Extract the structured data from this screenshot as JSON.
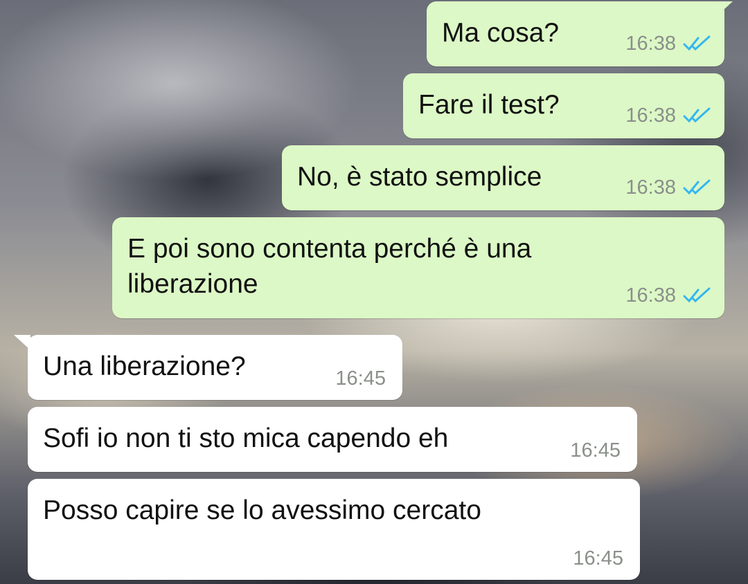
{
  "colors": {
    "outgoing_bubble": "#dcf8c6",
    "incoming_bubble": "#ffffff",
    "read_ticks": "#34b7f1",
    "timestamp": "#8a8f8a"
  },
  "messages": [
    {
      "direction": "outgoing",
      "text": "Ma cosa?",
      "time": "16:38",
      "status_icon": "double-check-read-icon"
    },
    {
      "direction": "outgoing",
      "text": "Fare il test?",
      "time": "16:38",
      "status_icon": "double-check-read-icon"
    },
    {
      "direction": "outgoing",
      "text": "No, è stato semplice",
      "time": "16:38",
      "status_icon": "double-check-read-icon"
    },
    {
      "direction": "outgoing",
      "text_line1": "E poi sono contenta perché è una",
      "text_line2": "liberazione",
      "time": "16:38",
      "status_icon": "double-check-read-icon"
    },
    {
      "direction": "incoming",
      "text": "Una liberazione?",
      "time": "16:45"
    },
    {
      "direction": "incoming",
      "text": "Sofi io non ti sto mica capendo eh",
      "time": "16:45"
    },
    {
      "direction": "incoming",
      "text": "Posso capire se lo avessimo cercato",
      "time": "16:45"
    }
  ]
}
